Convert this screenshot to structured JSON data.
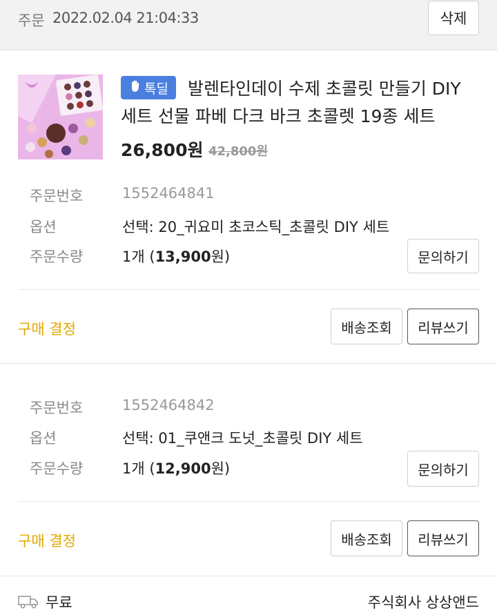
{
  "header": {
    "label": "주문",
    "date": "2022.02.04 21:04:33",
    "delete_label": "삭제"
  },
  "product": {
    "image_alt": "chocolate-diy-set-photo",
    "badge": "톡딜",
    "title": "발렌타인데이 수제 초콜릿 만들기 DIY 세트 선물 파베 다크 바크 초콜렛 19종 세트",
    "price": "26,800원",
    "original_price": "42,800원"
  },
  "labels": {
    "order_no": "주문번호",
    "option": "옵션",
    "quantity": "주문수량"
  },
  "orders": [
    {
      "order_no": "1552464841",
      "option": "선택: 20_귀요미 초코스틱_초콜릿 DIY 세트",
      "qty_prefix": "1개 (",
      "qty_amount": "13,900",
      "qty_suffix": "원)",
      "inquiry": "문의하기",
      "confirm": "구매 결정",
      "track": "배송조회",
      "review": "리뷰쓰기"
    },
    {
      "order_no": "1552464842",
      "option": "선택: 01_쿠앤크 도넛_초콜릿 DIY 세트",
      "qty_prefix": "1개 (",
      "qty_amount": "12,900",
      "qty_suffix": "원)",
      "inquiry": "문의하기",
      "confirm": "구매 결정",
      "track": "배송조회",
      "review": "리뷰쓰기"
    }
  ],
  "footer": {
    "shipping": "무료",
    "seller": "주식회사 상상앤드",
    "shipping_icon": "truck-icon"
  },
  "colors": {
    "accent": "#e0a800",
    "badge": "#4a7fe0"
  }
}
